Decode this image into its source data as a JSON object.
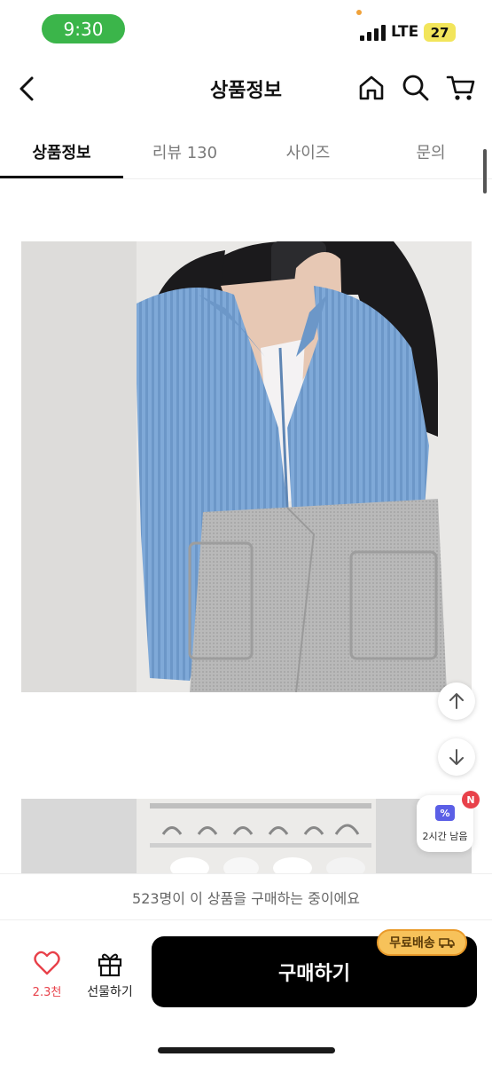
{
  "status_bar": {
    "time": "9:30",
    "network": "LTE",
    "battery": "27"
  },
  "header": {
    "title": "상품정보",
    "back_icon": "chevron-left-icon",
    "home_icon": "home-icon",
    "search_icon": "search-icon",
    "cart_icon": "cart-icon"
  },
  "tabs": [
    {
      "label": "상품정보",
      "active": true
    },
    {
      "label": "리뷰 130",
      "active": false
    },
    {
      "label": "사이즈",
      "active": false
    },
    {
      "label": "문의",
      "active": false
    }
  ],
  "floating": {
    "scroll_up_icon": "arrow-up-icon",
    "scroll_down_icon": "arrow-down-icon",
    "coupon_badge": "N",
    "coupon_label": "2시간 남음"
  },
  "notice": "523명이 이 상품을 구매하는 중이에요",
  "bottom_bar": {
    "like_count": "2.3천",
    "gift_label": "선물하기",
    "buy_label": "구매하기",
    "shipping_badge": "무료배송"
  },
  "colors": {
    "accent_red": "#e8414a",
    "buy_button": "#000000",
    "shipping_badge": "#f7c25a",
    "time_pill": "#3bb54a"
  }
}
